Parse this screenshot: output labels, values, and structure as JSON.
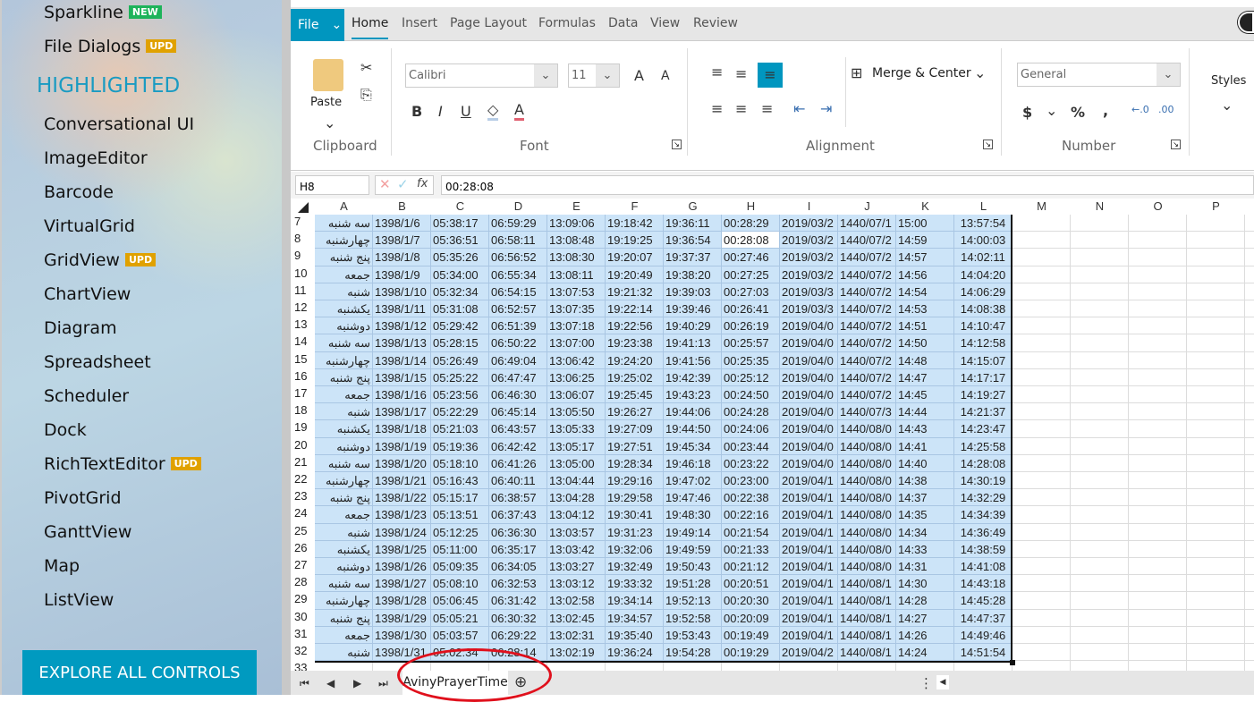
{
  "sidebar": {
    "items_top": [
      {
        "label": "Sparkline",
        "badge": "NEW",
        "badge_color": "#1db35a"
      },
      {
        "label": "File Dialogs",
        "badge": "UPD",
        "badge_color": "#e0a100"
      }
    ],
    "section": "HIGHLIGHTED",
    "items": [
      {
        "label": "Conversational UI"
      },
      {
        "label": "ImageEditor"
      },
      {
        "label": "Barcode"
      },
      {
        "label": "VirtualGrid"
      },
      {
        "label": "GridView",
        "badge": "UPD"
      },
      {
        "label": "ChartView"
      },
      {
        "label": "Diagram"
      },
      {
        "label": "Spreadsheet"
      },
      {
        "label": "Scheduler"
      },
      {
        "label": "Dock"
      },
      {
        "label": "RichTextEditor",
        "badge": "UPD"
      },
      {
        "label": "PivotGrid"
      },
      {
        "label": "GanttView"
      },
      {
        "label": "Map"
      },
      {
        "label": "ListView"
      }
    ],
    "explore": "EXPLORE ALL CONTROLS"
  },
  "ribbon": {
    "file": "File",
    "tabs": [
      "Home",
      "Insert",
      "Page Layout",
      "Formulas",
      "Data",
      "View",
      "Review"
    ],
    "paste": "Paste",
    "clipboard": "Clipboard",
    "font_group": "Font",
    "font": "Calibri",
    "size": "11",
    "alignment": "Alignment",
    "merge": "Merge & Center",
    "number": "Number",
    "format": "General",
    "styles": "Styles",
    "accent": "#0096bf"
  },
  "formula": {
    "cell": "H8",
    "fx": "fx",
    "value": "00:28:08"
  },
  "grid": {
    "columns": [
      "A",
      "B",
      "C",
      "D",
      "E",
      "F",
      "G",
      "H",
      "I",
      "J",
      "K",
      "L",
      "M",
      "N",
      "O",
      "P"
    ],
    "active_cell": "H8",
    "selection": "A7:L32",
    "rows": [
      {
        "n": "7",
        "c": [
          "سه شنبه",
          "1398/1/6",
          "05:38:17",
          "06:59:29",
          "13:09:06",
          "19:18:42",
          "19:36:11",
          "00:28:29",
          "2019/03/2",
          "1440/07/1",
          "15:00",
          "13:57:54"
        ]
      },
      {
        "n": "8",
        "c": [
          "چهارشنبه",
          "1398/1/7",
          "05:36:51",
          "06:58:11",
          "13:08:48",
          "19:19:25",
          "19:36:54",
          "00:28:08",
          "2019/03/2",
          "1440/07/2",
          "14:59",
          "14:00:03"
        ]
      },
      {
        "n": "9",
        "c": [
          "پنج شنبه",
          "1398/1/8",
          "05:35:26",
          "06:56:52",
          "13:08:30",
          "19:20:07",
          "19:37:37",
          "00:27:46",
          "2019/03/2",
          "1440/07/2",
          "14:57",
          "14:02:11"
        ]
      },
      {
        "n": "10",
        "c": [
          "جمعه",
          "1398/1/9",
          "05:34:00",
          "06:55:34",
          "13:08:11",
          "19:20:49",
          "19:38:20",
          "00:27:25",
          "2019/03/2",
          "1440/07/2",
          "14:56",
          "14:04:20"
        ]
      },
      {
        "n": "11",
        "c": [
          "شنبه",
          "1398/1/10",
          "05:32:34",
          "06:54:15",
          "13:07:53",
          "19:21:32",
          "19:39:03",
          "00:27:03",
          "2019/03/3",
          "1440/07/2",
          "14:54",
          "14:06:29"
        ]
      },
      {
        "n": "12",
        "c": [
          "یکشنبه",
          "1398/1/11",
          "05:31:08",
          "06:52:57",
          "13:07:35",
          "19:22:14",
          "19:39:46",
          "00:26:41",
          "2019/03/3",
          "1440/07/2",
          "14:53",
          "14:08:38"
        ]
      },
      {
        "n": "13",
        "c": [
          "دوشنبه",
          "1398/1/12",
          "05:29:42",
          "06:51:39",
          "13:07:18",
          "19:22:56",
          "19:40:29",
          "00:26:19",
          "2019/04/0",
          "1440/07/2",
          "14:51",
          "14:10:47"
        ]
      },
      {
        "n": "14",
        "c": [
          "سه شنبه",
          "1398/1/13",
          "05:28:15",
          "06:50:22",
          "13:07:00",
          "19:23:38",
          "19:41:13",
          "00:25:57",
          "2019/04/0",
          "1440/07/2",
          "14:50",
          "14:12:58"
        ]
      },
      {
        "n": "15",
        "c": [
          "چهارشنبه",
          "1398/1/14",
          "05:26:49",
          "06:49:04",
          "13:06:42",
          "19:24:20",
          "19:41:56",
          "00:25:35",
          "2019/04/0",
          "1440/07/2",
          "14:48",
          "14:15:07"
        ]
      },
      {
        "n": "16",
        "c": [
          "پنج شنبه",
          "1398/1/15",
          "05:25:22",
          "06:47:47",
          "13:06:25",
          "19:25:02",
          "19:42:39",
          "00:25:12",
          "2019/04/0",
          "1440/07/2",
          "14:47",
          "14:17:17"
        ]
      },
      {
        "n": "17",
        "c": [
          "جمعه",
          "1398/1/16",
          "05:23:56",
          "06:46:30",
          "13:06:07",
          "19:25:45",
          "19:43:23",
          "00:24:50",
          "2019/04/0",
          "1440/07/2",
          "14:45",
          "14:19:27"
        ]
      },
      {
        "n": "18",
        "c": [
          "شنبه",
          "1398/1/17",
          "05:22:29",
          "06:45:14",
          "13:05:50",
          "19:26:27",
          "19:44:06",
          "00:24:28",
          "2019/04/0",
          "1440/07/3",
          "14:44",
          "14:21:37"
        ]
      },
      {
        "n": "19",
        "c": [
          "یکشنبه",
          "1398/1/18",
          "05:21:03",
          "06:43:57",
          "13:05:33",
          "19:27:09",
          "19:44:50",
          "00:24:06",
          "2019/04/0",
          "1440/08/0",
          "14:43",
          "14:23:47"
        ]
      },
      {
        "n": "20",
        "c": [
          "دوشنبه",
          "1398/1/19",
          "05:19:36",
          "06:42:42",
          "13:05:17",
          "19:27:51",
          "19:45:34",
          "00:23:44",
          "2019/04/0",
          "1440/08/0",
          "14:41",
          "14:25:58"
        ]
      },
      {
        "n": "21",
        "c": [
          "سه شنبه",
          "1398/1/20",
          "05:18:10",
          "06:41:26",
          "13:05:00",
          "19:28:34",
          "19:46:18",
          "00:23:22",
          "2019/04/0",
          "1440/08/0",
          "14:40",
          "14:28:08"
        ]
      },
      {
        "n": "22",
        "c": [
          "چهارشنبه",
          "1398/1/21",
          "05:16:43",
          "06:40:11",
          "13:04:44",
          "19:29:16",
          "19:47:02",
          "00:23:00",
          "2019/04/1",
          "1440/08/0",
          "14:38",
          "14:30:19"
        ]
      },
      {
        "n": "23",
        "c": [
          "پنج شنبه",
          "1398/1/22",
          "05:15:17",
          "06:38:57",
          "13:04:28",
          "19:29:58",
          "19:47:46",
          "00:22:38",
          "2019/04/1",
          "1440/08/0",
          "14:37",
          "14:32:29"
        ]
      },
      {
        "n": "24",
        "c": [
          "جمعه",
          "1398/1/23",
          "05:13:51",
          "06:37:43",
          "13:04:12",
          "19:30:41",
          "19:48:30",
          "00:22:16",
          "2019/04/1",
          "1440/08/0",
          "14:35",
          "14:34:39"
        ]
      },
      {
        "n": "25",
        "c": [
          "شنبه",
          "1398/1/24",
          "05:12:25",
          "06:36:30",
          "13:03:57",
          "19:31:23",
          "19:49:14",
          "00:21:54",
          "2019/04/1",
          "1440/08/0",
          "14:34",
          "14:36:49"
        ]
      },
      {
        "n": "26",
        "c": [
          "یکشنبه",
          "1398/1/25",
          "05:11:00",
          "06:35:17",
          "13:03:42",
          "19:32:06",
          "19:49:59",
          "00:21:33",
          "2019/04/1",
          "1440/08/0",
          "14:33",
          "14:38:59"
        ]
      },
      {
        "n": "27",
        "c": [
          "دوشنبه",
          "1398/1/26",
          "05:09:35",
          "06:34:05",
          "13:03:27",
          "19:32:49",
          "19:50:43",
          "00:21:12",
          "2019/04/1",
          "1440/08/0",
          "14:31",
          "14:41:08"
        ]
      },
      {
        "n": "28",
        "c": [
          "سه شنبه",
          "1398/1/27",
          "05:08:10",
          "06:32:53",
          "13:03:12",
          "19:33:32",
          "19:51:28",
          "00:20:51",
          "2019/04/1",
          "1440/08/1",
          "14:30",
          "14:43:18"
        ]
      },
      {
        "n": "29",
        "c": [
          "چهارشنبه",
          "1398/1/28",
          "05:06:45",
          "06:31:42",
          "13:02:58",
          "19:34:14",
          "19:52:13",
          "00:20:30",
          "2019/04/1",
          "1440/08/1",
          "14:28",
          "14:45:28"
        ]
      },
      {
        "n": "30",
        "c": [
          "پنج شنبه",
          "1398/1/29",
          "05:05:21",
          "06:30:32",
          "13:02:45",
          "19:34:57",
          "19:52:58",
          "00:20:09",
          "2019/04/1",
          "1440/08/1",
          "14:27",
          "14:47:37"
        ]
      },
      {
        "n": "31",
        "c": [
          "جمعه",
          "1398/1/30",
          "05:03:57",
          "06:29:22",
          "13:02:31",
          "19:35:40",
          "19:53:43",
          "00:19:49",
          "2019/04/1",
          "1440/08/1",
          "14:26",
          "14:49:46"
        ]
      },
      {
        "n": "32",
        "c": [
          "شنبه",
          "1398/1/31",
          "05:02:34",
          "06:28:14",
          "13:02:19",
          "19:36:24",
          "19:54:28",
          "00:19:29",
          "2019/04/2",
          "1440/08/1",
          "14:24",
          "14:51:54"
        ]
      },
      {
        "n": "33",
        "c": []
      }
    ]
  },
  "sheets": {
    "active": "AvinyPrayerTime"
  }
}
